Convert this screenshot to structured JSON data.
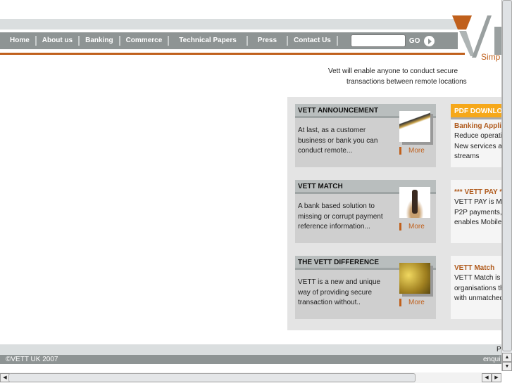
{
  "nav": {
    "items": [
      "Home",
      "About us",
      "Banking",
      "Commerce",
      "Technical Papers",
      "Press",
      "Contact Us"
    ],
    "search_value": "",
    "go_label": "GO"
  },
  "logo": {
    "text": "VETT",
    "slogan": "Simp"
  },
  "tagline": {
    "line1": "Vett will enable anyone to conduct secure",
    "line2": "transactions between remote locations"
  },
  "boxes": [
    {
      "title": "VETT ANNOUNCEMENT",
      "text": "At last, as a customer business or bank you can conduct remote...",
      "more": "More"
    },
    {
      "title": "VETT MATCH",
      "text": "A bank based solution to missing or corrupt payment reference information...",
      "more": "More"
    },
    {
      "title": "THE VETT DIFFERENCE",
      "text": "VETT is a new and unique way of providing secure transaction without..",
      "more": "More"
    }
  ],
  "right": {
    "pdf_header": "PDF DOWNLO",
    "items": [
      {
        "title": "Banking Appli",
        "lines": [
          "Reduce operati",
          "New services a",
          "streams"
        ]
      },
      {
        "title": "*** VETT PAY *",
        "lines": [
          "VETT PAY is M",
          "P2P payments,",
          "enables Mobile"
        ]
      },
      {
        "title": "VETT Match",
        "lines": [
          "VETT Match is",
          "organisations th",
          "with unmatched"
        ]
      }
    ]
  },
  "footer": {
    "copyright": "©VETT UK 2007",
    "right_top": "P",
    "right_email": "enqui"
  },
  "colors": {
    "accent": "#c0601c",
    "nav": "#8e9494",
    "pdf": "#f6a81a"
  }
}
